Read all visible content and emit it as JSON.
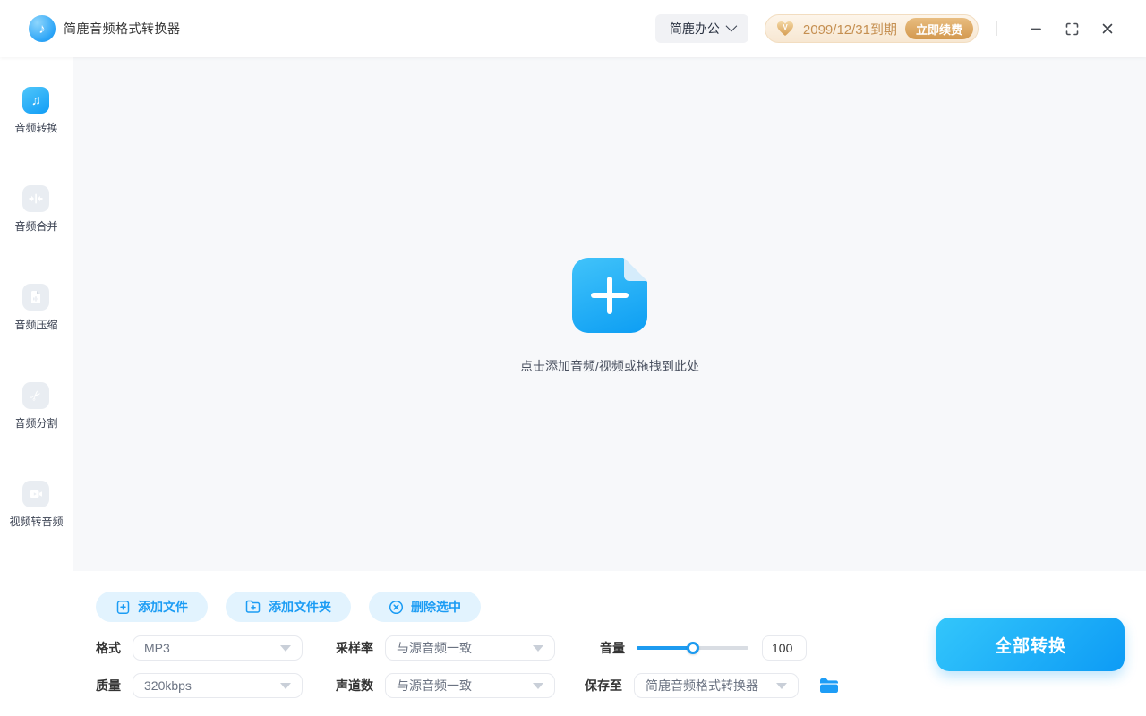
{
  "titlebar": {
    "app_title": "简鹿音频格式转换器",
    "workspace_menu": "简鹿办公",
    "vip": {
      "expiry": "2099/12/31到期",
      "renew_label": "立即续费"
    }
  },
  "sidebar": {
    "items": [
      {
        "label": "音频转换",
        "icon": "music-note-icon",
        "active": true
      },
      {
        "label": "音频合并",
        "icon": "merge-icon",
        "active": false
      },
      {
        "label": "音频压缩",
        "icon": "compress-file-icon",
        "active": false
      },
      {
        "label": "音频分割",
        "icon": "scissors-icon",
        "active": false
      },
      {
        "label": "视频转音频",
        "icon": "video-camera-icon",
        "active": false
      }
    ]
  },
  "dropzone": {
    "hint": "点击添加音频/视频或拖拽到此处"
  },
  "actions": {
    "add_file": "添加文件",
    "add_folder": "添加文件夹",
    "delete_selected": "删除选中"
  },
  "settings": {
    "format": {
      "label": "格式",
      "value": "MP3"
    },
    "sample_rate": {
      "label": "采样率",
      "value": "与源音频一致"
    },
    "volume": {
      "label": "音量",
      "value": "100",
      "percent": 50
    },
    "quality": {
      "label": "质量",
      "value": "320kbps"
    },
    "channels": {
      "label": "声道数",
      "value": "与源音频一致"
    },
    "save_to": {
      "label": "保存至",
      "value": "简鹿音频格式转换器"
    }
  },
  "convert_all_label": "全部转换",
  "colors": {
    "accent": "#1d9bf0",
    "accent_gradient_start": "#33c6fb",
    "accent_gradient_end": "#0d9bf5",
    "light_blue_button_bg": "#e2f3fe",
    "gold_text": "#c58f51",
    "gold_button": "#d3984e",
    "dropzone_bg": "#f7f8fa"
  }
}
